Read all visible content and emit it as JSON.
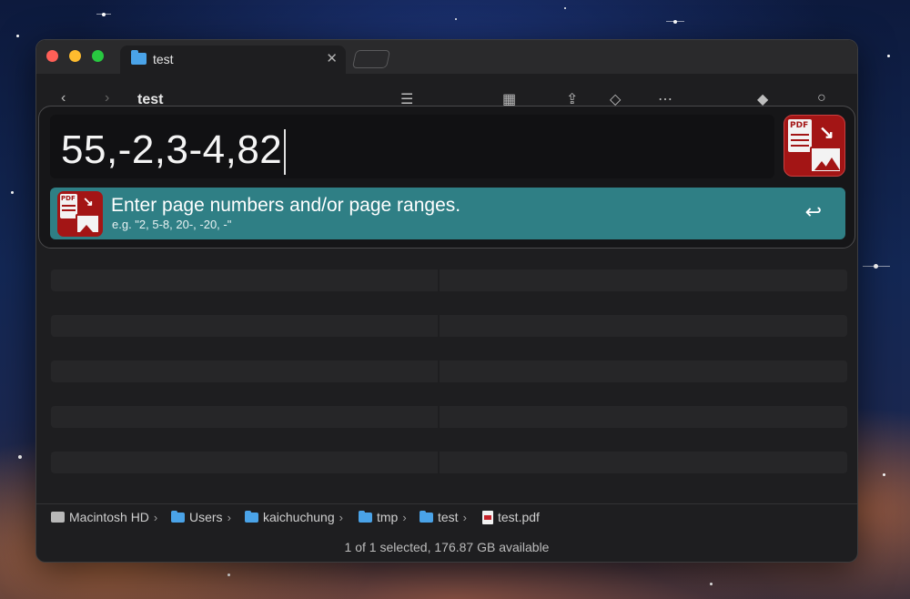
{
  "window": {
    "tab_title": "test",
    "toolbar_title": "test"
  },
  "launcher": {
    "query": "55,-2,3-4,82",
    "result": {
      "title": "Enter page numbers and/or page ranges.",
      "subtitle": "e.g. \"2, 5-8, 20-, -20, -\"",
      "return_symbol": "↩"
    },
    "icon_label": "PDF"
  },
  "pathbar": {
    "items": [
      {
        "label": "Macintosh HD",
        "icon": "hard-drive-icon"
      },
      {
        "label": "Users",
        "icon": "folder-icon"
      },
      {
        "label": "kaichuchung",
        "icon": "home-folder-icon"
      },
      {
        "label": "tmp",
        "icon": "folder-icon"
      },
      {
        "label": "test",
        "icon": "folder-icon"
      },
      {
        "label": "test.pdf",
        "icon": "pdf-file-icon"
      }
    ],
    "separator": "›"
  },
  "statusbar": {
    "text": "1 of 1 selected, 176.87 GB available"
  },
  "colors": {
    "result_highlight": "#2f7f85",
    "app_icon": "#a31515",
    "folder": "#4aa3e8"
  }
}
